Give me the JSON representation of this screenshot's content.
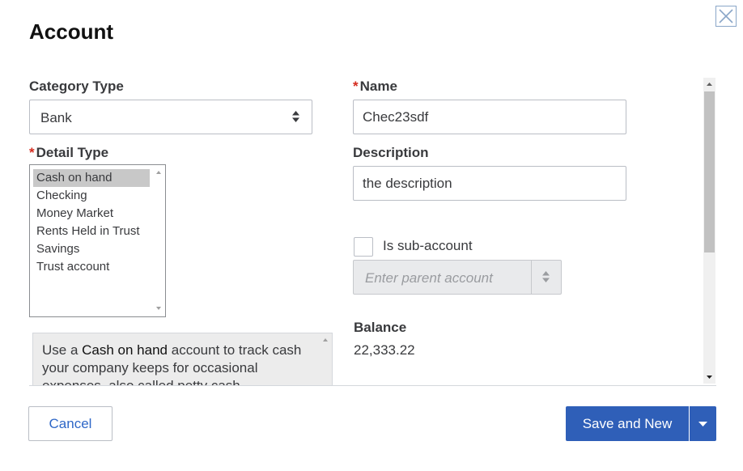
{
  "dialog": {
    "title": "Account"
  },
  "category_type": {
    "label": "Category Type",
    "value": "Bank"
  },
  "detail_type": {
    "required_mark": "*",
    "label": "Detail Type",
    "options": [
      "Cash on hand",
      "Checking",
      "Money Market",
      "Rents Held in Trust",
      "Savings",
      "Trust account"
    ],
    "selected": "Cash on hand"
  },
  "help": {
    "prefix": "Use a ",
    "bold": "Cash on hand",
    "suffix": " account to track cash your company keeps for occasional expenses, also called petty cash."
  },
  "name": {
    "required_mark": "*",
    "label": "Name",
    "value": "Chec23sdf"
  },
  "description": {
    "label": "Description",
    "value": "the description"
  },
  "sub_account": {
    "label": "Is sub-account",
    "checked": false,
    "placeholder": "Enter parent account"
  },
  "balance": {
    "label": "Balance",
    "value": "22,333.22"
  },
  "footer": {
    "cancel_label": "Cancel",
    "save_label": "Save and New"
  },
  "colors": {
    "primary": "#2f5fb8",
    "link": "#2e67c7",
    "required": "#d52b1e"
  },
  "icons": [
    "close-icon",
    "select-arrows-icon",
    "dropdown-caret-icon",
    "scroll-up-icon",
    "scroll-down-icon"
  ]
}
